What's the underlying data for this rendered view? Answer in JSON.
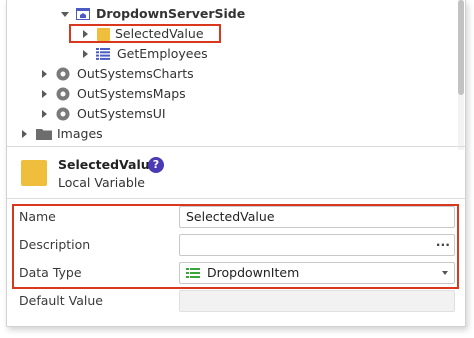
{
  "tree": {
    "items": [
      {
        "label": "DropdownServerSide",
        "icon": "screen-icon"
      },
      {
        "label": "SelectedValue",
        "icon": "local-variable-icon"
      },
      {
        "label": "GetEmployees",
        "icon": "aggregate-icon"
      },
      {
        "label": "OutSystemsCharts",
        "icon": "module-icon"
      },
      {
        "label": "OutSystemsMaps",
        "icon": "module-icon"
      },
      {
        "label": "OutSystemsUI",
        "icon": "module-icon"
      },
      {
        "label": "Images",
        "icon": "folder-icon"
      }
    ]
  },
  "header": {
    "title": "SelectedValue",
    "subtitle": "Local Variable",
    "help_glyph": "?"
  },
  "properties": {
    "name_label": "Name",
    "name_value": "SelectedValue",
    "description_label": "Description",
    "description_value": "",
    "description_button": "...",
    "datatype_label": "Data Type",
    "datatype_value": "DropdownItem",
    "default_label": "Default Value",
    "default_value": ""
  },
  "colors": {
    "highlight": "#d9381e",
    "variable_icon": "#f0be3d",
    "help_icon": "#4a3bb5",
    "aggregate_icon": "#4a5cc4"
  }
}
